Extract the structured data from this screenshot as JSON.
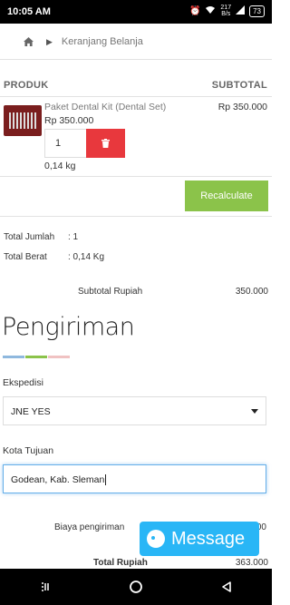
{
  "status_bar": {
    "time": "10:05 AM",
    "net_speed_top": "217",
    "net_speed_unit": "B/s",
    "battery": "73"
  },
  "breadcrumb": {
    "current": "Keranjang Belanja"
  },
  "cart": {
    "col_product": "PRODUK",
    "col_subtotal": "SUBTOTAL",
    "item": {
      "name": "Paket Dental Kit (Dental Set)",
      "price": "Rp 350.000",
      "quantity": "1",
      "weight": "0,14 kg",
      "subtotal": "Rp 350.000"
    },
    "recalculate_label": "Recalculate"
  },
  "summary": {
    "total_jumlah_label": "Total Jumlah",
    "total_jumlah_value": ": 1",
    "total_berat_label": "Total Berat",
    "total_berat_value": ": 0,14 Kg",
    "subtotal_label": "Subtotal Rupiah",
    "subtotal_value": "350.000"
  },
  "shipping": {
    "heading": "Pengiriman",
    "expedisi_label": "Ekspedisi",
    "expedisi_value": "JNE YES",
    "kota_label": "Kota Tujuan",
    "kota_value": "Godean, Kab. Sleman",
    "biaya_label": "Biaya pengiriman",
    "biaya_value_partial": "00",
    "total_label": "Total Rupiah",
    "total_value": "363.000"
  },
  "message_button": {
    "label": "Message"
  },
  "colors": {
    "delete_red": "#e8383d",
    "recalc_green": "#8bc34a",
    "message_blue": "#29b6f6"
  }
}
